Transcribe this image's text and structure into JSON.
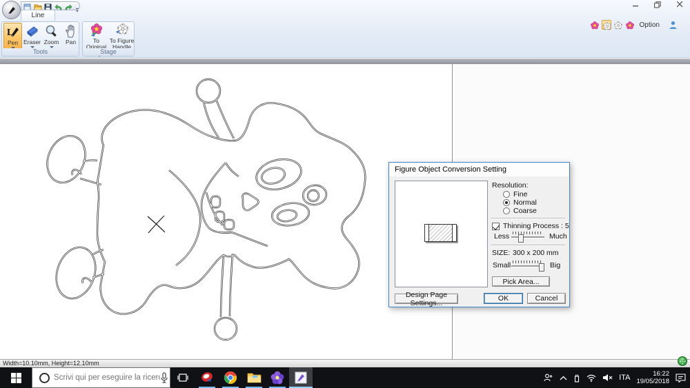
{
  "app": {
    "tab_label": "Line Image",
    "option_label": "Option",
    "ribbon": {
      "tools": {
        "label": "Tools",
        "pen": "Pen",
        "eraser": "Eraser",
        "zoom": "Zoom",
        "pan": "Pan"
      },
      "stage": {
        "label": "Stage",
        "to_original": "To Original Image",
        "to_figure": "To Figure Handle"
      }
    }
  },
  "dialog": {
    "title": "Figure Object Conversion Setting",
    "resolution_label": "Resolution:",
    "radio_fine": "Fine",
    "radio_normal": "Normal",
    "radio_coarse": "Coarse",
    "selected_resolution": "Normal",
    "thinning_label": "Thinning Process : 5",
    "thinning_checked": true,
    "less_label": "Less",
    "much_label": "Much",
    "size_label": "SIZE:",
    "size_value": "300 x 200 mm",
    "small_label": "Small",
    "big_label": "Big",
    "pick_area_label": "Pick Area...",
    "design_page_label": "Design Page Settings...",
    "ok_label": "OK",
    "cancel_label": "Cancel"
  },
  "status": {
    "text": "Width=10.10mm, Height=12.10mm"
  },
  "taskbar": {
    "search_placeholder": "Scrivi qui per eseguire la ricerca",
    "tray_language": "ITA",
    "tray_time": "16:22",
    "tray_date": "19/05/2018"
  }
}
